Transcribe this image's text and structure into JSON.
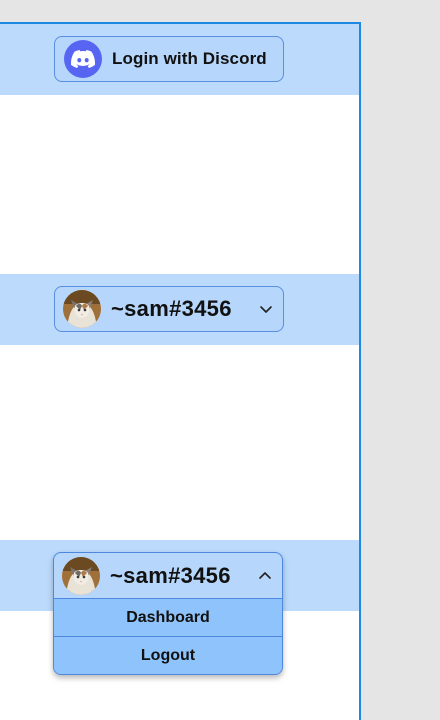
{
  "colors": {
    "accent_border": "#1e88e5",
    "band": "#bbdafc",
    "button": "#b6d6fb",
    "menu": "#8fc3fb",
    "discord": "#5865f2"
  },
  "login": {
    "icon": "discord-logo-icon",
    "label": "Login with Discord"
  },
  "user_closed": {
    "avatar": "cat-avatar",
    "username": "~sam#3456",
    "chevron": "chevron-down-icon"
  },
  "user_open": {
    "avatar": "cat-avatar",
    "username": "~sam#3456",
    "chevron": "chevron-up-icon",
    "menu": [
      {
        "label": "Dashboard"
      },
      {
        "label": "Logout"
      }
    ]
  }
}
